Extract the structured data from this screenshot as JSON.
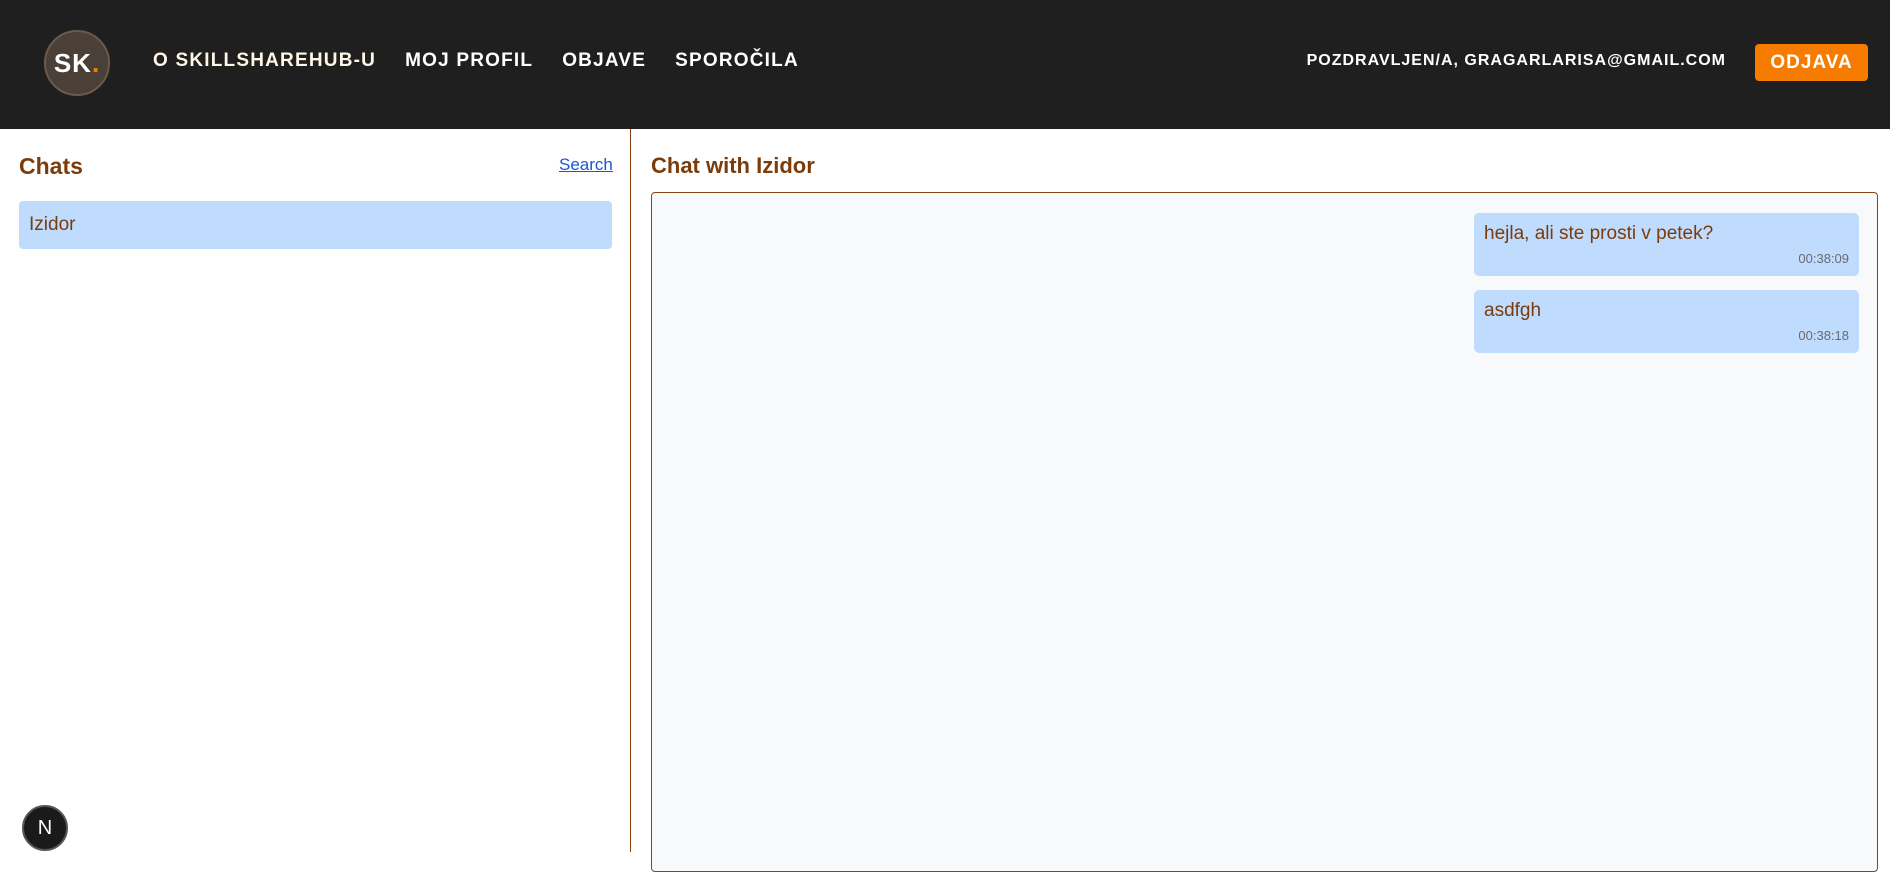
{
  "header": {
    "logo_text": "SK",
    "logo_dot": ".",
    "nav": [
      {
        "label": "O SKILLSHAREHUB-U"
      },
      {
        "label": "MOJ PROFIL"
      },
      {
        "label": "OBJAVE"
      },
      {
        "label": "SPOROČILA"
      }
    ],
    "greeting": "POZDRAVLJEN/A, GRAGARLARISA@GMAIL.COM",
    "logout_label": "ODJAVA"
  },
  "sidebar": {
    "title": "Chats",
    "search_label": "Search",
    "chats": [
      {
        "name": "Izidor"
      }
    ]
  },
  "main": {
    "title": "Chat with Izidor",
    "messages": [
      {
        "text": "hejla, ali ste prosti v petek?",
        "time": "00:38:09"
      },
      {
        "text": "asdfgh",
        "time": "00:38:18"
      }
    ]
  },
  "floating": {
    "label": "N"
  },
  "colors": {
    "accent": "#f57c00",
    "header_bg": "#1f1f1f",
    "title_brown": "#7a3c0a",
    "bubble": "#bfdbfe"
  }
}
